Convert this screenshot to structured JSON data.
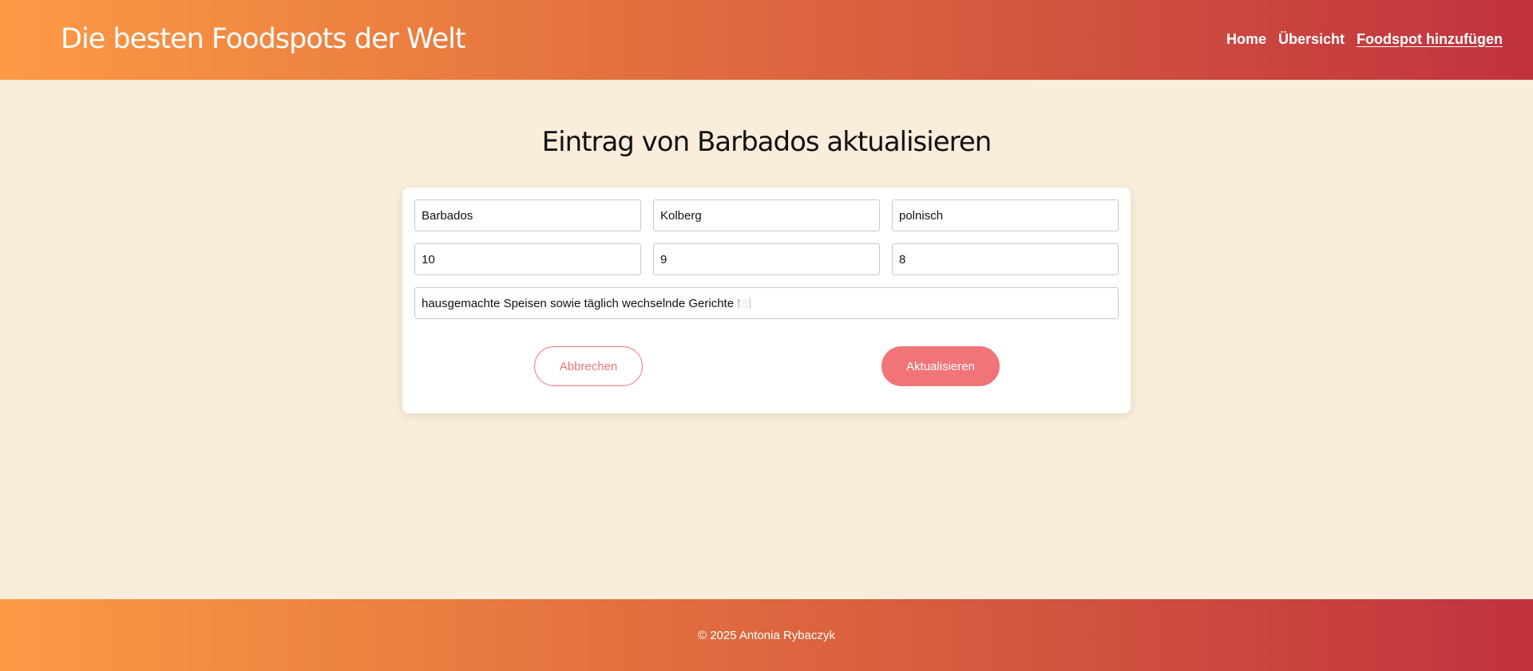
{
  "header": {
    "title": "Die besten Foodspots der Welt",
    "nav": [
      {
        "label": "Home"
      },
      {
        "label": "Übersicht"
      },
      {
        "label": "Foodspot hinzufügen"
      }
    ]
  },
  "main": {
    "heading": "Eintrag von Barbados aktualisieren",
    "form": {
      "name": "Barbados",
      "city": "Kolberg",
      "cuisine": "polnisch",
      "rating1": "10",
      "rating2": "9",
      "rating3": "8",
      "description": "hausgemachte Speisen sowie täglich wechselnde Gerichte 🍽️"
    },
    "cancel_label": "Abbrechen",
    "update_label": "Aktualisieren"
  },
  "footer": {
    "copyright": "© 2025 Antonia Rybaczyk"
  },
  "colors": {
    "accent": "#f07478",
    "background": "#faeddc",
    "gradient_start": "#fc9a45",
    "gradient_end": "#c0323e"
  }
}
